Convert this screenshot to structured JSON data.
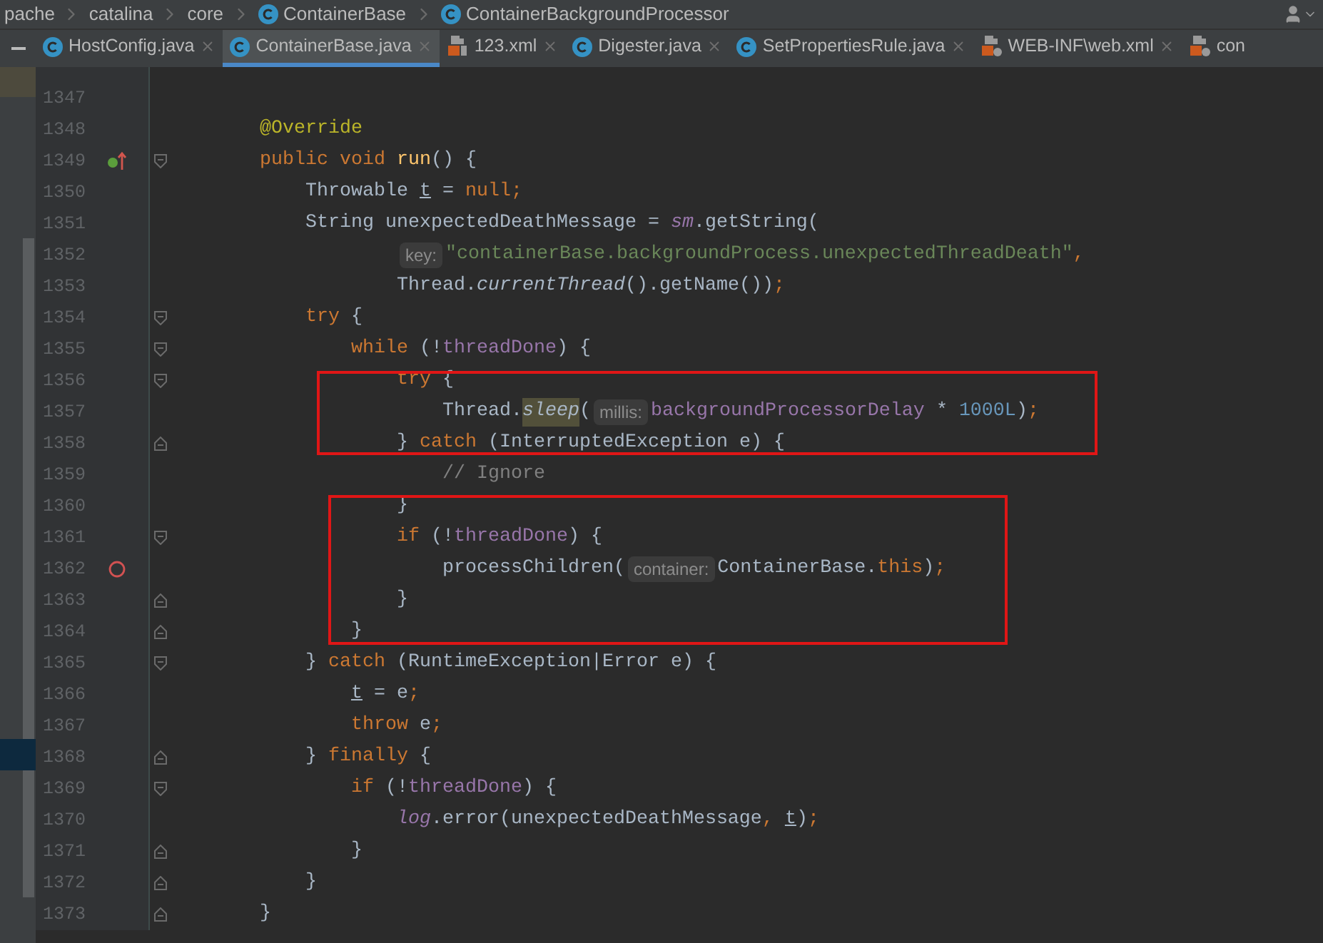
{
  "breadcrumb": [
    {
      "label": "pache",
      "kind": "package"
    },
    {
      "label": "catalina",
      "kind": "package"
    },
    {
      "label": "core",
      "kind": "package"
    },
    {
      "label": "ContainerBase",
      "kind": "class"
    },
    {
      "label": "ContainerBackgroundProcessor",
      "kind": "class"
    }
  ],
  "tabs": [
    {
      "label": "HostConfig.java",
      "kind": "class",
      "selected": false,
      "closable": true
    },
    {
      "label": "ContainerBase.java",
      "kind": "class",
      "selected": true,
      "closable": true
    },
    {
      "label": "123.xml",
      "kind": "xml",
      "selected": false,
      "closable": true
    },
    {
      "label": "Digester.java",
      "kind": "class",
      "selected": false,
      "closable": true
    },
    {
      "label": "SetPropertiesRule.java",
      "kind": "class",
      "selected": false,
      "closable": true
    },
    {
      "label": "WEB-INF\\web.xml",
      "kind": "webxml",
      "selected": false,
      "closable": true
    },
    {
      "label": "con",
      "kind": "webxml",
      "selected": false,
      "closable": false
    }
  ],
  "lines": [
    {
      "number": "1347"
    },
    {
      "number": "1348",
      "tokens": [
        {
          "text": "    @Override",
          "kind": "ann"
        }
      ]
    },
    {
      "number": "1349",
      "override_marker": true,
      "fold_start": true,
      "tokens": [
        {
          "text": "    public void ",
          "kind": "kw"
        },
        {
          "text": "run",
          "kind": "decl"
        },
        {
          "text": "() {",
          "kind": "plain"
        }
      ]
    },
    {
      "number": "1350",
      "tokens": [
        {
          "text": "        Throwable ",
          "kind": "plain"
        },
        {
          "text": "t",
          "kind": "var"
        },
        {
          "text": " = ",
          "kind": "plain"
        },
        {
          "text": "null;",
          "kind": "kw"
        }
      ]
    },
    {
      "number": "1351",
      "tokens": [
        {
          "text": "        String unexpectedDeathMessage = ",
          "kind": "plain"
        },
        {
          "text": "sm",
          "kind": "sfield"
        },
        {
          "text": ".getString(",
          "kind": "plain"
        }
      ]
    },
    {
      "number": "1352",
      "tokens": [
        {
          "text": "                key:",
          "kind": "hint"
        },
        {
          "text": "\"containerBase.backgroundProcess.unexpectedThreadDeath\"",
          "kind": "str"
        },
        {
          "text": ",",
          "kind": "kw"
        }
      ]
    },
    {
      "number": "1353",
      "tokens": [
        {
          "text": "                Thread.",
          "kind": "plain"
        },
        {
          "text": "currentThread",
          "kind": "smethod"
        },
        {
          "text": "().getName())",
          "kind": "plain"
        },
        {
          "text": ";",
          "kind": "kw"
        }
      ]
    },
    {
      "number": "1354",
      "fold_start": true,
      "tokens": [
        {
          "text": "        try ",
          "kind": "kw"
        },
        {
          "text": "{",
          "kind": "plain"
        }
      ]
    },
    {
      "number": "1355",
      "fold_start": true,
      "tokens": [
        {
          "text": "            while ",
          "kind": "kw"
        },
        {
          "text": "(!",
          "kind": "plain"
        },
        {
          "text": "threadDone",
          "kind": "field"
        },
        {
          "text": ") {",
          "kind": "plain"
        }
      ]
    },
    {
      "number": "1356",
      "fold_start": true,
      "tokens": [
        {
          "text": "                try ",
          "kind": "kw"
        },
        {
          "text": "{",
          "kind": "plain"
        }
      ]
    },
    {
      "number": "1357",
      "tokens": [
        {
          "text": "                    Thread.",
          "kind": "plain"
        },
        {
          "text": "sleep",
          "kind": "smethod-hl"
        },
        {
          "text": "(",
          "kind": "plain"
        },
        {
          "text": "millis:",
          "kind": "hint"
        },
        {
          "text": "backgroundProcessorDelay",
          "kind": "field"
        },
        {
          "text": " * ",
          "kind": "plain"
        },
        {
          "text": "1000L",
          "kind": "num"
        },
        {
          "text": ")",
          "kind": "plain"
        },
        {
          "text": ";",
          "kind": "kw"
        }
      ]
    },
    {
      "number": "1358",
      "fold_end": true,
      "tokens": [
        {
          "text": "                } ",
          "kind": "plain"
        },
        {
          "text": "catch ",
          "kind": "kw"
        },
        {
          "text": "(InterruptedException e) {",
          "kind": "plain"
        }
      ]
    },
    {
      "number": "1359",
      "tokens": [
        {
          "text": "                    // Ignore",
          "kind": "comment"
        }
      ]
    },
    {
      "number": "1360",
      "tokens": [
        {
          "text": "                }",
          "kind": "plain"
        }
      ]
    },
    {
      "number": "1361",
      "fold_start": true,
      "tokens": [
        {
          "text": "                if ",
          "kind": "kw"
        },
        {
          "text": "(!",
          "kind": "plain"
        },
        {
          "text": "threadDone",
          "kind": "field"
        },
        {
          "text": ") {",
          "kind": "plain"
        }
      ]
    },
    {
      "number": "1362",
      "breakpoint": true,
      "tokens": [
        {
          "text": "                    processChildren(",
          "kind": "plain"
        },
        {
          "text": "container:",
          "kind": "hint"
        },
        {
          "text": "ContainerBase.",
          "kind": "plain"
        },
        {
          "text": "this",
          "kind": "kw"
        },
        {
          "text": ")",
          "kind": "plain"
        },
        {
          "text": ";",
          "kind": "kw"
        }
      ]
    },
    {
      "number": "1363",
      "fold_end": true,
      "tokens": [
        {
          "text": "                }",
          "kind": "plain"
        }
      ]
    },
    {
      "number": "1364",
      "fold_end": true,
      "tokens": [
        {
          "text": "            }",
          "kind": "plain"
        }
      ]
    },
    {
      "number": "1365",
      "fold_start": true,
      "tokens": [
        {
          "text": "        } ",
          "kind": "plain"
        },
        {
          "text": "catch ",
          "kind": "kw"
        },
        {
          "text": "(RuntimeException|Error e) {",
          "kind": "plain"
        }
      ]
    },
    {
      "number": "1366",
      "tokens": [
        {
          "text": "            t",
          "kind": "var"
        },
        {
          "text": " = e",
          "kind": "plain"
        },
        {
          "text": ";",
          "kind": "kw"
        }
      ]
    },
    {
      "number": "1367",
      "tokens": [
        {
          "text": "            throw ",
          "kind": "kw"
        },
        {
          "text": "e",
          "kind": "plain"
        },
        {
          "text": ";",
          "kind": "kw"
        }
      ]
    },
    {
      "number": "1368",
      "fold_end": true,
      "tokens": [
        {
          "text": "        } ",
          "kind": "plain"
        },
        {
          "text": "finally ",
          "kind": "kw"
        },
        {
          "text": "{",
          "kind": "plain"
        }
      ]
    },
    {
      "number": "1369",
      "fold_start": true,
      "tokens": [
        {
          "text": "            if ",
          "kind": "kw"
        },
        {
          "text": "(!",
          "kind": "plain"
        },
        {
          "text": "threadDone",
          "kind": "field"
        },
        {
          "text": ") {",
          "kind": "plain"
        }
      ]
    },
    {
      "number": "1370",
      "tokens": [
        {
          "text": "                log",
          "kind": "sfield"
        },
        {
          "text": ".error(unexpectedDeathMessage",
          "kind": "plain"
        },
        {
          "text": ", ",
          "kind": "kw"
        },
        {
          "text": "t",
          "kind": "var"
        },
        {
          "text": ")",
          "kind": "plain"
        },
        {
          "text": ";",
          "kind": "kw"
        }
      ]
    },
    {
      "number": "1371",
      "fold_end": true,
      "tokens": [
        {
          "text": "            }",
          "kind": "plain"
        }
      ]
    },
    {
      "number": "1372",
      "fold_end": true,
      "tokens": [
        {
          "text": "        }",
          "kind": "plain"
        }
      ]
    },
    {
      "number": "1373",
      "fold_end": true,
      "tokens": [
        {
          "text": "    }",
          "kind": "plain"
        }
      ]
    }
  ]
}
